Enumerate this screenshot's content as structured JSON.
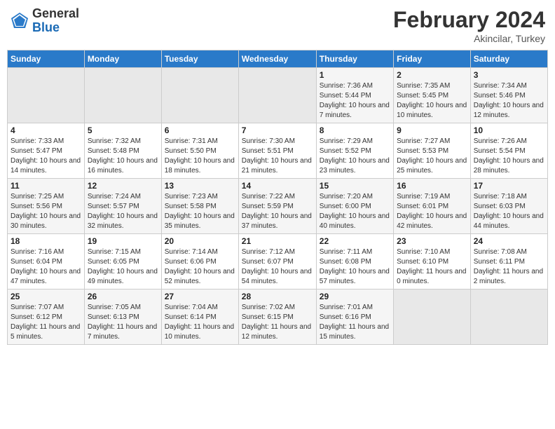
{
  "logo": {
    "general": "General",
    "blue": "Blue"
  },
  "header": {
    "month_year": "February 2024",
    "location": "Akincilar, Turkey"
  },
  "weekdays": [
    "Sunday",
    "Monday",
    "Tuesday",
    "Wednesday",
    "Thursday",
    "Friday",
    "Saturday"
  ],
  "weeks": [
    [
      {
        "day": "",
        "empty": true
      },
      {
        "day": "",
        "empty": true
      },
      {
        "day": "",
        "empty": true
      },
      {
        "day": "",
        "empty": true
      },
      {
        "day": "1",
        "sunrise": "7:36 AM",
        "sunset": "5:44 PM",
        "daylight": "10 hours and 7 minutes."
      },
      {
        "day": "2",
        "sunrise": "7:35 AM",
        "sunset": "5:45 PM",
        "daylight": "10 hours and 10 minutes."
      },
      {
        "day": "3",
        "sunrise": "7:34 AM",
        "sunset": "5:46 PM",
        "daylight": "10 hours and 12 minutes."
      }
    ],
    [
      {
        "day": "4",
        "sunrise": "7:33 AM",
        "sunset": "5:47 PM",
        "daylight": "10 hours and 14 minutes."
      },
      {
        "day": "5",
        "sunrise": "7:32 AM",
        "sunset": "5:48 PM",
        "daylight": "10 hours and 16 minutes."
      },
      {
        "day": "6",
        "sunrise": "7:31 AM",
        "sunset": "5:50 PM",
        "daylight": "10 hours and 18 minutes."
      },
      {
        "day": "7",
        "sunrise": "7:30 AM",
        "sunset": "5:51 PM",
        "daylight": "10 hours and 21 minutes."
      },
      {
        "day": "8",
        "sunrise": "7:29 AM",
        "sunset": "5:52 PM",
        "daylight": "10 hours and 23 minutes."
      },
      {
        "day": "9",
        "sunrise": "7:27 AM",
        "sunset": "5:53 PM",
        "daylight": "10 hours and 25 minutes."
      },
      {
        "day": "10",
        "sunrise": "7:26 AM",
        "sunset": "5:54 PM",
        "daylight": "10 hours and 28 minutes."
      }
    ],
    [
      {
        "day": "11",
        "sunrise": "7:25 AM",
        "sunset": "5:56 PM",
        "daylight": "10 hours and 30 minutes."
      },
      {
        "day": "12",
        "sunrise": "7:24 AM",
        "sunset": "5:57 PM",
        "daylight": "10 hours and 32 minutes."
      },
      {
        "day": "13",
        "sunrise": "7:23 AM",
        "sunset": "5:58 PM",
        "daylight": "10 hours and 35 minutes."
      },
      {
        "day": "14",
        "sunrise": "7:22 AM",
        "sunset": "5:59 PM",
        "daylight": "10 hours and 37 minutes."
      },
      {
        "day": "15",
        "sunrise": "7:20 AM",
        "sunset": "6:00 PM",
        "daylight": "10 hours and 40 minutes."
      },
      {
        "day": "16",
        "sunrise": "7:19 AM",
        "sunset": "6:01 PM",
        "daylight": "10 hours and 42 minutes."
      },
      {
        "day": "17",
        "sunrise": "7:18 AM",
        "sunset": "6:03 PM",
        "daylight": "10 hours and 44 minutes."
      }
    ],
    [
      {
        "day": "18",
        "sunrise": "7:16 AM",
        "sunset": "6:04 PM",
        "daylight": "10 hours and 47 minutes."
      },
      {
        "day": "19",
        "sunrise": "7:15 AM",
        "sunset": "6:05 PM",
        "daylight": "10 hours and 49 minutes."
      },
      {
        "day": "20",
        "sunrise": "7:14 AM",
        "sunset": "6:06 PM",
        "daylight": "10 hours and 52 minutes."
      },
      {
        "day": "21",
        "sunrise": "7:12 AM",
        "sunset": "6:07 PM",
        "daylight": "10 hours and 54 minutes."
      },
      {
        "day": "22",
        "sunrise": "7:11 AM",
        "sunset": "6:08 PM",
        "daylight": "10 hours and 57 minutes."
      },
      {
        "day": "23",
        "sunrise": "7:10 AM",
        "sunset": "6:10 PM",
        "daylight": "11 hours and 0 minutes."
      },
      {
        "day": "24",
        "sunrise": "7:08 AM",
        "sunset": "6:11 PM",
        "daylight": "11 hours and 2 minutes."
      }
    ],
    [
      {
        "day": "25",
        "sunrise": "7:07 AM",
        "sunset": "6:12 PM",
        "daylight": "11 hours and 5 minutes."
      },
      {
        "day": "26",
        "sunrise": "7:05 AM",
        "sunset": "6:13 PM",
        "daylight": "11 hours and 7 minutes."
      },
      {
        "day": "27",
        "sunrise": "7:04 AM",
        "sunset": "6:14 PM",
        "daylight": "11 hours and 10 minutes."
      },
      {
        "day": "28",
        "sunrise": "7:02 AM",
        "sunset": "6:15 PM",
        "daylight": "11 hours and 12 minutes."
      },
      {
        "day": "29",
        "sunrise": "7:01 AM",
        "sunset": "6:16 PM",
        "daylight": "11 hours and 15 minutes."
      },
      {
        "day": "",
        "empty": true
      },
      {
        "day": "",
        "empty": true
      }
    ]
  ],
  "labels": {
    "sunrise": "Sunrise:",
    "sunset": "Sunset:",
    "daylight": "Daylight:"
  }
}
